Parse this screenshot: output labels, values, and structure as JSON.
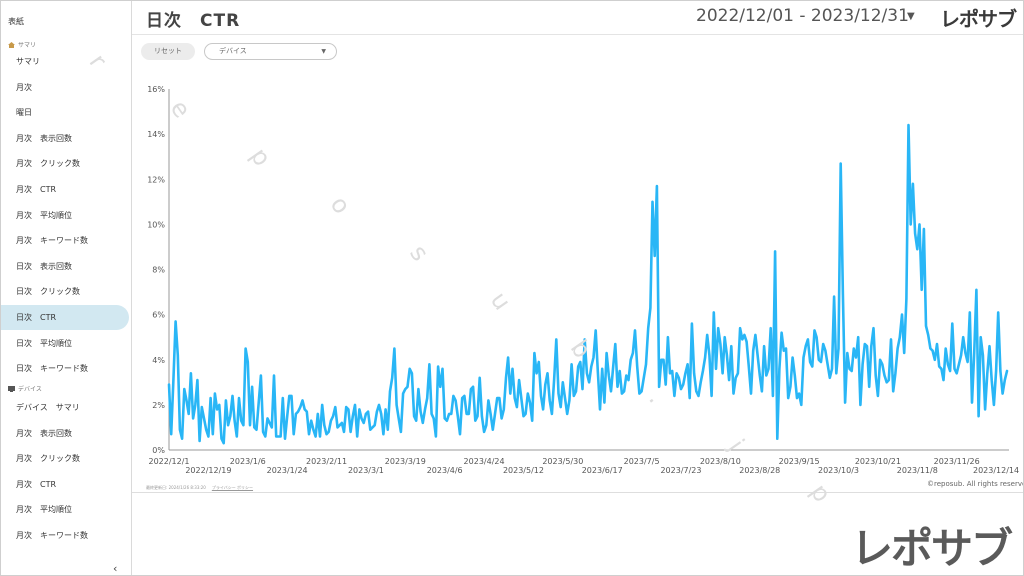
{
  "sidebar": {
    "top_item": "表紙",
    "group_summary": "サマリ",
    "group_device": "デバイス",
    "items_summary": [
      "サマリ",
      "月次",
      "曜日",
      "月次　表示回数",
      "月次　クリック数",
      "月次　CTR",
      "月次　平均順位",
      "月次　キーワード数",
      "日次　表示回数",
      "日次　クリック数",
      "日次　CTR",
      "日次　平均順位",
      "日次　キーワード数"
    ],
    "items_device": [
      "デバイス　サマリ",
      "月次　表示回数",
      "月次　クリック数",
      "月次　CTR",
      "月次　平均順位",
      "月次　キーワード数"
    ],
    "active_index": 10,
    "collapse_icon": "‹"
  },
  "header": {
    "title": "日次　CTR",
    "date_range": "2022/12/01 - 2023/12/31",
    "dropdown_icon": "▼",
    "logo": "レポサブ"
  },
  "controls": {
    "reset_label": "リセット",
    "device_placeholder": "デバイス",
    "device_dropdown_icon": "▼"
  },
  "footer": {
    "updated": "最終更新日: 2024/1/26 8:33:20",
    "privacy": "プライバシー ポリシー",
    "copyright": "©reposub. All rights reserved.",
    "big_logo": "レポサブ"
  },
  "watermark": [
    "r",
    "e",
    "p",
    "o",
    "s",
    "u",
    "b",
    ".",
    "j",
    "p"
  ],
  "colors": {
    "line": "#29b6f6",
    "active_bg": "#d2e8f1",
    "axis": "#999999"
  },
  "chart_data": {
    "type": "line",
    "title": "",
    "xlabel": "",
    "ylabel": "",
    "ylim": [
      0,
      16
    ],
    "y_ticks": [
      "0%",
      "2%",
      "4%",
      "6%",
      "8%",
      "10%",
      "12%",
      "14%",
      "16%"
    ],
    "x_tick_labels": [
      {
        "label": "2022/12/1",
        "day": 0,
        "row": 1
      },
      {
        "label": "2022/12/19",
        "day": 18,
        "row": 2
      },
      {
        "label": "2023/1/6",
        "day": 36,
        "row": 1
      },
      {
        "label": "2023/1/24",
        "day": 54,
        "row": 2
      },
      {
        "label": "2023/2/11",
        "day": 72,
        "row": 1
      },
      {
        "label": "2023/3/1",
        "day": 90,
        "row": 2
      },
      {
        "label": "2023/3/19",
        "day": 108,
        "row": 1
      },
      {
        "label": "2023/4/6",
        "day": 126,
        "row": 2
      },
      {
        "label": "2023/4/24",
        "day": 144,
        "row": 1
      },
      {
        "label": "2023/5/12",
        "day": 162,
        "row": 2
      },
      {
        "label": "2023/5/30",
        "day": 180,
        "row": 1
      },
      {
        "label": "2023/6/17",
        "day": 198,
        "row": 2
      },
      {
        "label": "2023/7/5",
        "day": 216,
        "row": 1
      },
      {
        "label": "2023/7/23",
        "day": 234,
        "row": 2
      },
      {
        "label": "2023/8/10",
        "day": 252,
        "row": 1
      },
      {
        "label": "2023/8/28",
        "day": 270,
        "row": 2
      },
      {
        "label": "2023/9/15",
        "day": 288,
        "row": 1
      },
      {
        "label": "2023/10/3",
        "day": 306,
        "row": 2
      },
      {
        "label": "2023/10/21",
        "day": 324,
        "row": 1
      },
      {
        "label": "2023/11/8",
        "day": 342,
        "row": 2
      },
      {
        "label": "2023/11/26",
        "day": 360,
        "row": 1
      },
      {
        "label": "2023/12/14",
        "day": 378,
        "row": 2
      }
    ],
    "grid": false,
    "legend": "none",
    "series": [
      {
        "start_date": "2022/12/01",
        "values": [
          2.9,
          0.7,
          3.1,
          5.7,
          4.2,
          0.9,
          0.5,
          2.7,
          2.2,
          1.6,
          3.4,
          1.4,
          2.0,
          3.1,
          0.4,
          1.9,
          1.4,
          0.9,
          0.6,
          2.3,
          0.7,
          2.5,
          1.8,
          2.0,
          0.5,
          0.3,
          2.2,
          1.1,
          1.5,
          2.4,
          1.3,
          0.6,
          2.3,
          1.3,
          1.1,
          4.5,
          3.9,
          1.1,
          2.8,
          1.0,
          0.9,
          2.1,
          3.3,
          0.8,
          0.6,
          1.4,
          1.2,
          1.0,
          3.3,
          0.6,
          0.6,
          0.6,
          2.3,
          0.5,
          1.5,
          2.4,
          2.4,
          0.7,
          1.6,
          1.7,
          1.9,
          2.2,
          1.8,
          1.7,
          0.7,
          1.3,
          0.9,
          0.6,
          1.6,
          0.6,
          2.0,
          1.1,
          0.7,
          0.8,
          1.3,
          1.5,
          1.9,
          1.0,
          1.1,
          1.2,
          0.8,
          1.9,
          1.8,
          0.8,
          1.5,
          2.0,
          0.6,
          1.8,
          1.4,
          1.2,
          1.6,
          1.7,
          0.9,
          1.0,
          1.1,
          1.7,
          2.0,
          1.6,
          0.7,
          1.8,
          0.9,
          2.6,
          3.2,
          4.5,
          2.0,
          1.4,
          0.8,
          2.5,
          2.7,
          2.8,
          3.6,
          3.4,
          1.5,
          1.3,
          2.7,
          1.7,
          1.2,
          1.8,
          2.3,
          3.8,
          1.6,
          1.4,
          0.6,
          3.7,
          2.8,
          3.6,
          1.4,
          1.3,
          1.6,
          1.6,
          2.4,
          2.2,
          1.5,
          0.7,
          2.3,
          2.4,
          1.6,
          1.6,
          2.7,
          2.8,
          1.3,
          1.5,
          3.2,
          1.5,
          0.8,
          1.1,
          2.2,
          1.6,
          0.9,
          1.6,
          2.3,
          2.3,
          1.4,
          1.8,
          3.2,
          4.1,
          2.5,
          3.6,
          2.3,
          1.9,
          3.1,
          2.3,
          1.5,
          1.6,
          2.5,
          2.1,
          1.3,
          4.3,
          3.4,
          3.9,
          2.4,
          1.8,
          2.9,
          3.4,
          2.2,
          1.6,
          3.1,
          4.9,
          2.5,
          1.9,
          3.0,
          2.3,
          1.6,
          2.2,
          3.8,
          2.4,
          2.6,
          3.7,
          3.9,
          2.7,
          4.9,
          3.4,
          3.0,
          3.7,
          4.1,
          5.3,
          3.5,
          1.8,
          3.6,
          2.1,
          4.3,
          3.3,
          2.6,
          3.7,
          4.7,
          2.8,
          3.5,
          2.5,
          2.6,
          3.3,
          3.1,
          4.0,
          4.3,
          5.3,
          3.7,
          2.5,
          2.6,
          3.2,
          3.8,
          5.4,
          6.3,
          11.0,
          8.6,
          11.7,
          2.8,
          4.0,
          4.0,
          2.9,
          5.0,
          3.4,
          3.5,
          2.4,
          3.4,
          3.2,
          2.7,
          2.9,
          3.4,
          3.8,
          2.3,
          5.6,
          3.4,
          2.6,
          2.4,
          3.0,
          3.5,
          4.1,
          5.1,
          4.2,
          2.4,
          6.1,
          3.6,
          5.4,
          4.7,
          3.4,
          5.0,
          4.2,
          3.1,
          4.6,
          2.5,
          3.2,
          3.4,
          5.4,
          4.9,
          5.1,
          4.8,
          3.7,
          2.5,
          4.4,
          5.1,
          4.2,
          3.3,
          2.6,
          4.6,
          3.3,
          3.6,
          5.4,
          2.4,
          8.8,
          0.5,
          3.6,
          5.2,
          4.4,
          4.5,
          2.3,
          2.8,
          4.1,
          3.3,
          2.3,
          2.5,
          2.0,
          4.1,
          4.6,
          4.9,
          3.9,
          3.7,
          5.3,
          5.0,
          4.0,
          3.9,
          4.7,
          4.4,
          3.8,
          3.2,
          3.6,
          6.8,
          3.4,
          4.5,
          12.7,
          6.9,
          2.1,
          4.3,
          3.6,
          3.5,
          4.5,
          4.1,
          5.0,
          2.0,
          3.8,
          4.7,
          4.6,
          2.8,
          4.6,
          5.4,
          3.3,
          2.4,
          4.0,
          3.8,
          3.3,
          3.0,
          3.1,
          4.9,
          2.6,
          3.4,
          4.5,
          5.0,
          6.0,
          4.3,
          6.7,
          14.4,
          10.0,
          11.8,
          9.6,
          8.9,
          10.0,
          7.1,
          9.8,
          5.5,
          5.1,
          4.5,
          4.4,
          4.0,
          4.7,
          3.7,
          3.6,
          3.1,
          4.5,
          3.8,
          3.5,
          5.6,
          3.6,
          3.4,
          3.8,
          4.2,
          5.0,
          4.3,
          3.9,
          6.1,
          2.1,
          4.3,
          7.1,
          1.5,
          5.0,
          4.2,
          1.8,
          3.4,
          4.6,
          3.1,
          2.0,
          3.5,
          6.1,
          3.5,
          2.5,
          3.1,
          3.5
        ]
      }
    ]
  }
}
